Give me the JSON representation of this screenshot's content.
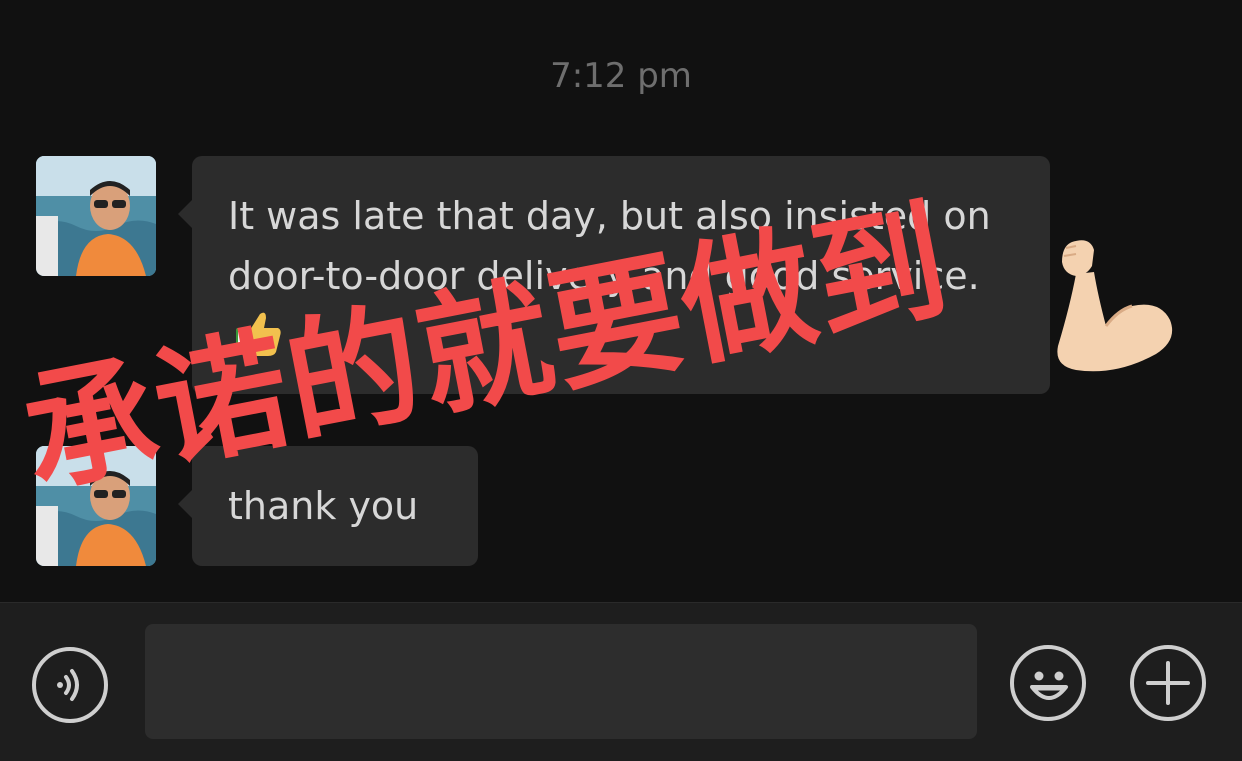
{
  "chat": {
    "timestamp": "7:12 pm",
    "messages": [
      {
        "sender": "contact",
        "text": "It was late that day, but also insisted on door-to-door delivery and good service.",
        "emoji": "thumbs-up"
      },
      {
        "sender": "contact",
        "text": "thank you"
      }
    ]
  },
  "overlay": {
    "text": "承诺的就要做到",
    "color": "#f24a4a",
    "emoji": "flexed-biceps"
  },
  "input_bar": {
    "voice_button": "voice-icon",
    "text_value": "",
    "emoji_button": "smiley-icon",
    "more_button": "plus-icon"
  },
  "colors": {
    "background": "#111111",
    "bubble": "#2c2c2c",
    "bubble_text": "#d7d7d7",
    "input_bar": "#1e1e1e"
  }
}
